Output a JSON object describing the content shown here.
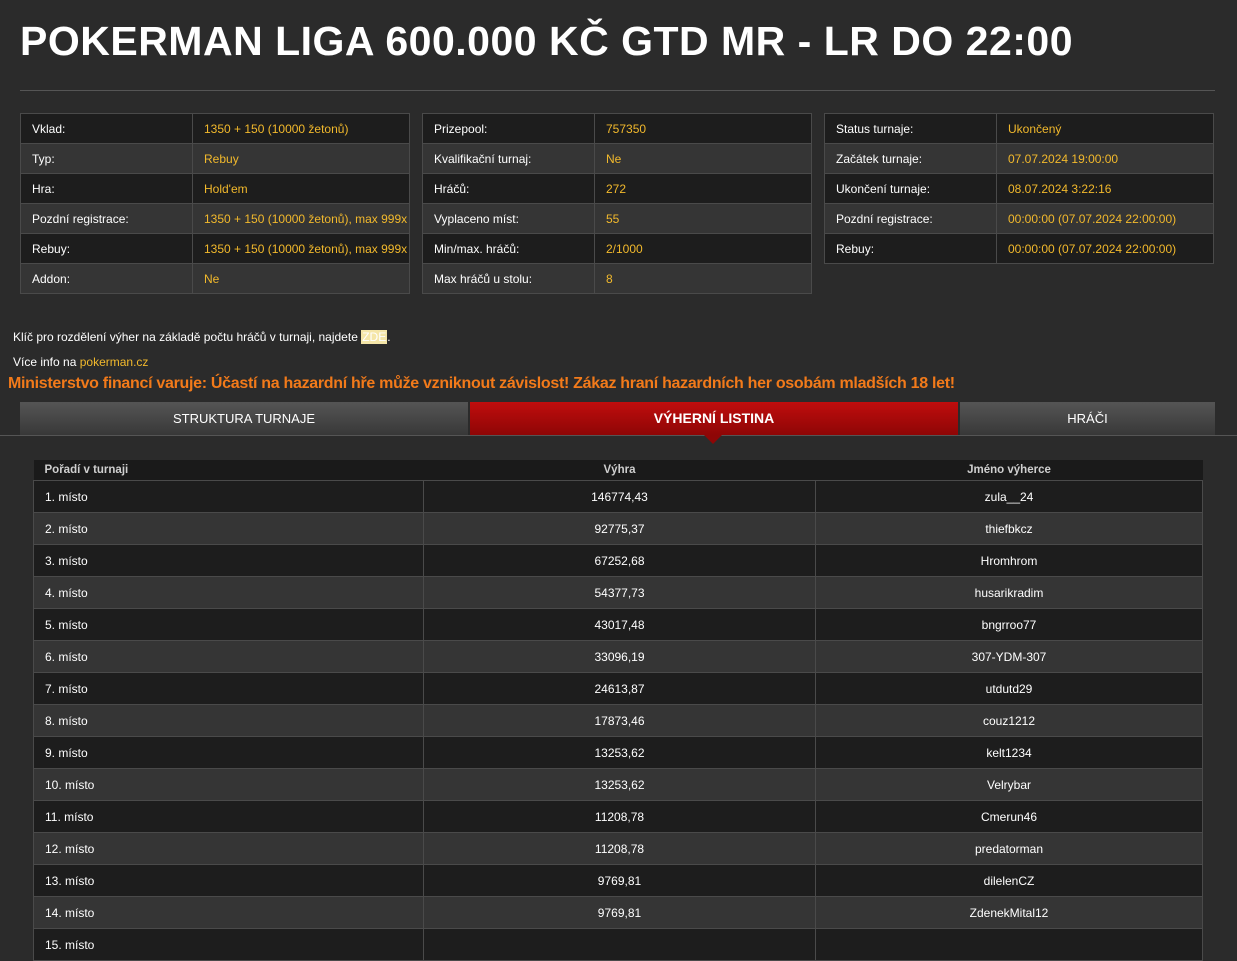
{
  "title": "POKERMAN LIGA 600.000 KČ GTD MR - LR DO 22:00",
  "info_left": [
    {
      "key": "Vklad:",
      "value": "1350 + 150 (10000 žetonů)"
    },
    {
      "key": "Typ:",
      "value": "Rebuy"
    },
    {
      "key": "Hra:",
      "value": "Hold'em"
    },
    {
      "key": "Pozdní registrace:",
      "value": "1350 + 150 (10000 žetonů), max 999x"
    },
    {
      "key": "Rebuy:",
      "value": "1350 + 150 (10000 žetonů), max 999x"
    },
    {
      "key": "Addon:",
      "value": "Ne"
    }
  ],
  "info_middle": [
    {
      "key": "Prizepool:",
      "value": "757350"
    },
    {
      "key": "Kvalifikační turnaj:",
      "value": "Ne"
    },
    {
      "key": "Hráčů:",
      "value": "272"
    },
    {
      "key": "Vyplaceno míst:",
      "value": "55"
    },
    {
      "key": "Min/max. hráčů:",
      "value": "2/1000"
    },
    {
      "key": "Max hráčů u stolu:",
      "value": "8"
    }
  ],
  "info_right": [
    {
      "key": "Status turnaje:",
      "value": "Ukončený"
    },
    {
      "key": "Začátek turnaje:",
      "value": "07.07.2024 19:00:00"
    },
    {
      "key": "Ukončení turnaje:",
      "value": "08.07.2024 3:22:16"
    },
    {
      "key": "Pozdní registrace:",
      "value": "00:00:00 (07.07.2024 22:00:00)"
    },
    {
      "key": "Rebuy:",
      "value": "00:00:00 (07.07.2024 22:00:00)"
    }
  ],
  "notes": {
    "key_text": "Klíč pro rozdělení výher na základě počtu hráčů v turnaji, najdete",
    "key_link": "ZDE",
    "key_end": ".",
    "more_text": "Více info na",
    "more_link": "pokerman.cz"
  },
  "warning": "Ministerstvo financí varuje: Účastí na hazardní hře může vzniknout závislost! Zákaz hraní hazardních her osobám mladších 18 let!",
  "tabs": {
    "structure": "STRUKTURA TURNAJE",
    "payouts": "VÝHERNÍ LISTINA",
    "players": "HRÁČI"
  },
  "payouts": {
    "headers": [
      "Pořadí v turnaji",
      "Výhra",
      "Jméno výherce"
    ],
    "rows": [
      [
        "1. místo",
        "146774,43",
        "zula__24"
      ],
      [
        "2. místo",
        "92775,37",
        "thiefbkcz"
      ],
      [
        "3. místo",
        "67252,68",
        "Hromhrom"
      ],
      [
        "4. místo",
        "54377,73",
        "husarikradim"
      ],
      [
        "5. místo",
        "43017,48",
        "bngrroo77"
      ],
      [
        "6. místo",
        "33096,19",
        "307-YDM-307"
      ],
      [
        "7. místo",
        "24613,87",
        "utdutd29"
      ],
      [
        "8. místo",
        "17873,46",
        "couz1212"
      ],
      [
        "9. místo",
        "13253,62",
        "kelt1234"
      ],
      [
        "10. místo",
        "13253,62",
        "Velrybar"
      ],
      [
        "11. místo",
        "11208,78",
        "Cmerun46"
      ],
      [
        "12. místo",
        "11208,78",
        "predatorman"
      ],
      [
        "13. místo",
        "9769,81",
        "dilelenCZ"
      ],
      [
        "14. místo",
        "9769,81",
        "ZdenekMital12"
      ],
      [
        "15. místo",
        "",
        ""
      ]
    ]
  }
}
